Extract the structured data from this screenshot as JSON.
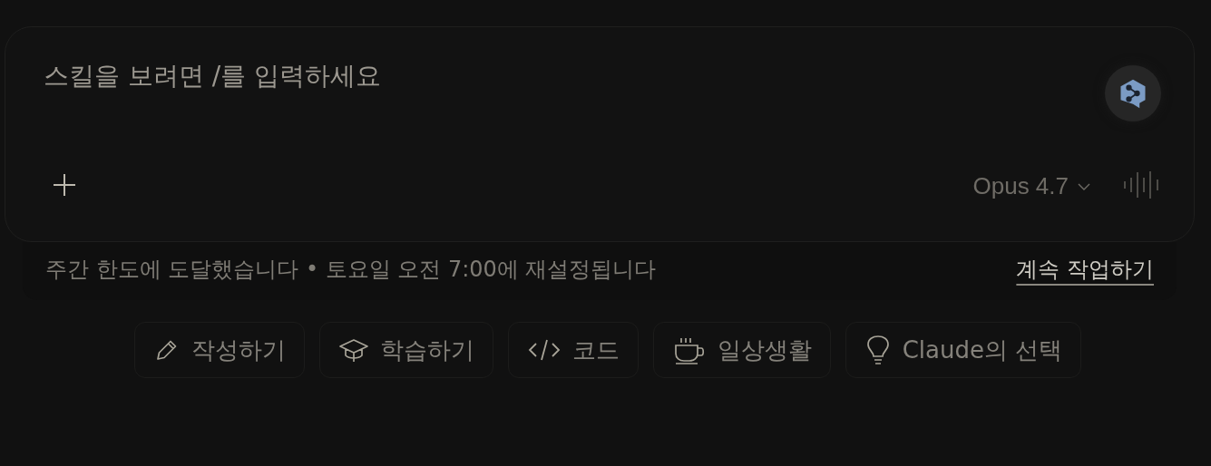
{
  "composer": {
    "placeholder": "스킬을 보려면 /를 입력하세요",
    "model": "Opus 4.7"
  },
  "limit_notice": {
    "message": "주간 한도에 도달했습니다 • 토요일 오전 7:00에 재설정됩니다",
    "action": "계속 작업하기"
  },
  "suggestions": [
    {
      "label": "작성하기"
    },
    {
      "label": "학습하기"
    },
    {
      "label": "코드"
    },
    {
      "label": "일상생활"
    },
    {
      "label": "Claude의 선택"
    }
  ]
}
